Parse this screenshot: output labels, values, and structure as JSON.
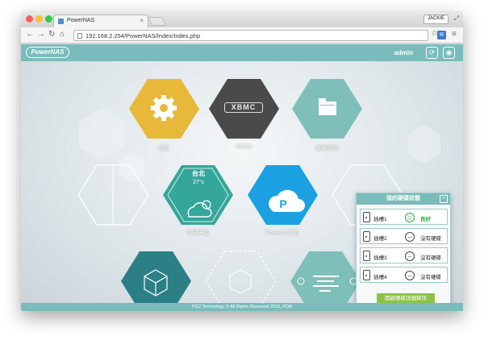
{
  "browser": {
    "tab_title": "PowerNAS",
    "user_badge": "JACKIE",
    "url": "192.168.2.254/PowerNAS/Index/Index.php"
  },
  "header": {
    "logo": "PowerNAS",
    "user": "admin"
  },
  "apps": {
    "settings": {
      "label": "設定",
      "color": "#e8b83b"
    },
    "xbmc": {
      "label": "XBMC",
      "logo_text": "XBMC",
      "color": "#4a4a4a"
    },
    "files": {
      "label": "檔案管理",
      "color": "#7fbfba"
    },
    "weather": {
      "label": "今日天氣",
      "city": "台北",
      "temp": "27°c",
      "color": "#35a69a"
    },
    "power_tools": {
      "label": "Power小工具",
      "color": "#1ba1e2"
    },
    "cube": {
      "color": "#2b7f85"
    },
    "list": {
      "color": "#7fbfba"
    }
  },
  "disk_panel": {
    "title": "我的硬碟狀態",
    "slots": [
      {
        "name": "插槽1",
        "status": "良好",
        "healthy": true
      },
      {
        "name": "插槽2",
        "status": "沒有硬碟",
        "healthy": false
      },
      {
        "name": "插槽3",
        "status": "沒有硬碟",
        "healthy": false
      },
      {
        "name": "插槽4",
        "status": "沒有硬碟",
        "healthy": false
      }
    ],
    "button": "開啟硬碟詳細資訊",
    "good_color": "#2ea84a",
    "button_color": "#8cc346"
  },
  "footer": {
    "text": "ITE2 Technology © All Rights Reserved 2015, PDM"
  }
}
